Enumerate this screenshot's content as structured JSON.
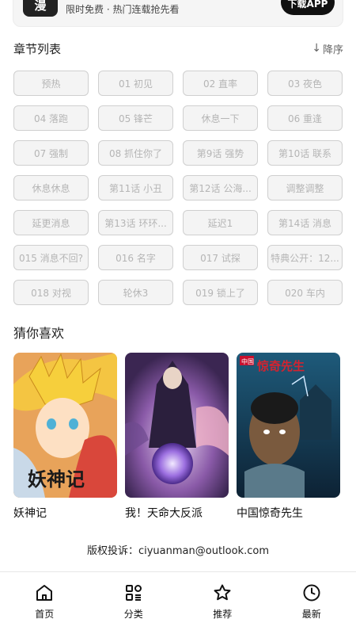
{
  "banner": {
    "logo": "漫",
    "subtitle": "限时免费 · 热门连载抢先看",
    "button": "下载APP"
  },
  "chapters": {
    "title": "章节列表",
    "sort_label": "降序",
    "items": [
      "预热",
      "01 初见",
      "02 直率",
      "03 夜色",
      "04 落跑",
      "05 锋芒",
      "休息一下",
      "06 重逢",
      "07 强制",
      "08 抓住你了",
      "第9话 强势",
      "第10话 联系",
      "休息休息",
      "第11话 小丑",
      "第12话 公海...",
      "调整调整",
      "延更消息",
      "第13话 环环...",
      "延迟1",
      "第14话 消息",
      "015 消息不回?",
      "016 名字",
      "017 试探",
      "特典公开：12...",
      "018 对视",
      "轮休3",
      "019 锁上了",
      "020 车内"
    ]
  },
  "recommend": {
    "title": "猜你喜欢",
    "items": [
      {
        "name": "妖神记",
        "cover_text": "妖神记"
      },
      {
        "name": "我！天命大反派",
        "cover_text": ""
      },
      {
        "name": "中国惊奇先生",
        "cover_text": "中国惊奇先生"
      }
    ]
  },
  "footer": {
    "copyright": "版权投诉：ciyuanman@outlook.com"
  },
  "nav": {
    "items": [
      {
        "label": "首页",
        "icon": "home-icon"
      },
      {
        "label": "分类",
        "icon": "category-icon"
      },
      {
        "label": "推荐",
        "icon": "star-icon"
      },
      {
        "label": "最新",
        "icon": "clock-icon"
      }
    ]
  }
}
